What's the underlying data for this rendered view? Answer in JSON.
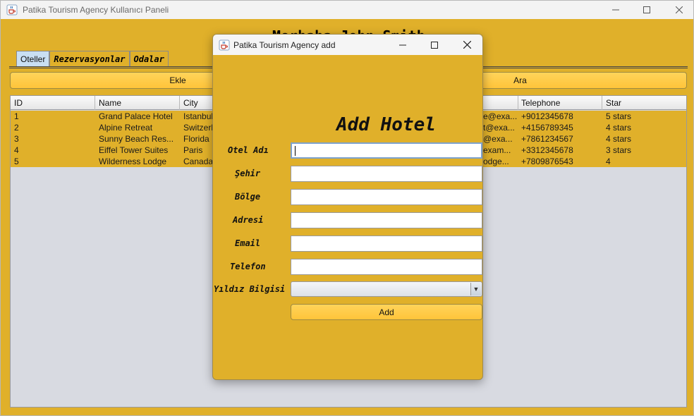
{
  "window": {
    "title": "Patika Tourism Agency Kullanıcı Paneli",
    "greeting": "Merhaba John Smith"
  },
  "tabs": [
    "Oteller",
    "Rezervasyonlar",
    "Odalar"
  ],
  "actions": {
    "add": "Ekle",
    "search": "Ara"
  },
  "table": {
    "headers": [
      "ID",
      "Name",
      "City",
      "",
      "",
      "Telephone",
      "Star"
    ],
    "rows": [
      [
        "1",
        "Grand Palace Hotel",
        "Istanbul",
        "e@exa...",
        "+9012345678",
        "5 stars"
      ],
      [
        "2",
        "Alpine Retreat",
        "Switzerl",
        "t@exa...",
        "+4156789345",
        "4 stars"
      ],
      [
        "3",
        "Sunny Beach Res...",
        "Florida",
        "@exa...",
        "+7861234567",
        "4 stars"
      ],
      [
        "4",
        "Eiffel Tower Suites",
        "Paris",
        "exam...",
        "+3312345678",
        "3 stars"
      ],
      [
        "5",
        "Wilderness Lodge",
        "Canada",
        "odge...",
        "+7809876543",
        "4"
      ]
    ]
  },
  "dialog": {
    "title": "Patika Tourism Agency add",
    "heading": "Add Hotel",
    "fields": {
      "name": {
        "label": "Otel Adı",
        "value": ""
      },
      "city": {
        "label": "Şehir",
        "value": ""
      },
      "region": {
        "label": "Bölge",
        "value": ""
      },
      "address": {
        "label": "Adresi",
        "value": ""
      },
      "email": {
        "label": "Email",
        "value": ""
      },
      "phone": {
        "label": "Telefon",
        "value": ""
      },
      "stars": {
        "label": "Yıldız Bilgisi",
        "value": ""
      }
    },
    "submit_label": "Add"
  },
  "colors": {
    "background": "#e0b02a",
    "button": "#ffc43a",
    "active_tab": "#c9dff3",
    "table_empty": "#d8dae1"
  },
  "icons": {
    "app": "java-cup-icon",
    "minimize": "minimize-icon",
    "maximize": "maximize-icon",
    "close": "close-icon",
    "dropdown": "chevron-down-icon"
  }
}
